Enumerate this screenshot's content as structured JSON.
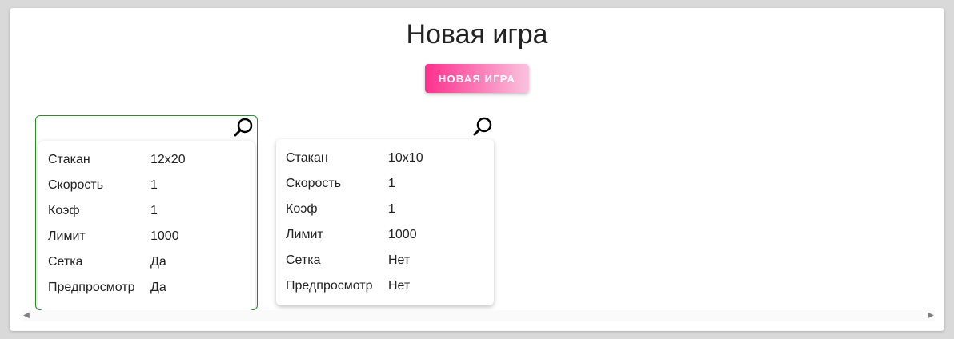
{
  "header": {
    "title": "Новая игра",
    "new_game_button": "НОВАЯ ИГРА"
  },
  "games": [
    {
      "selected": true,
      "settings": [
        {
          "label": "Стакан",
          "value": "12x20"
        },
        {
          "label": "Скорость",
          "value": "1"
        },
        {
          "label": "Коэф",
          "value": "1"
        },
        {
          "label": "Лимит",
          "value": "1000"
        },
        {
          "label": "Сетка",
          "value": "Да"
        },
        {
          "label": "Предпросмотр",
          "value": "Да"
        }
      ]
    },
    {
      "selected": false,
      "settings": [
        {
          "label": "Стакан",
          "value": "10x10"
        },
        {
          "label": "Скорость",
          "value": "1"
        },
        {
          "label": "Коэф",
          "value": "1"
        },
        {
          "label": "Лимит",
          "value": "1000"
        },
        {
          "label": "Сетка",
          "value": "Нет"
        },
        {
          "label": "Предпросмотр",
          "value": "Нет"
        }
      ]
    }
  ],
  "colors": {
    "accent_start": "#ff2f8e",
    "accent_end": "#f9c3de",
    "selected_border": "#2e8b2e"
  },
  "icons": {
    "zoom": "magnifier-icon",
    "scroll_left": "arrow-left-icon",
    "scroll_right": "arrow-right-icon"
  }
}
